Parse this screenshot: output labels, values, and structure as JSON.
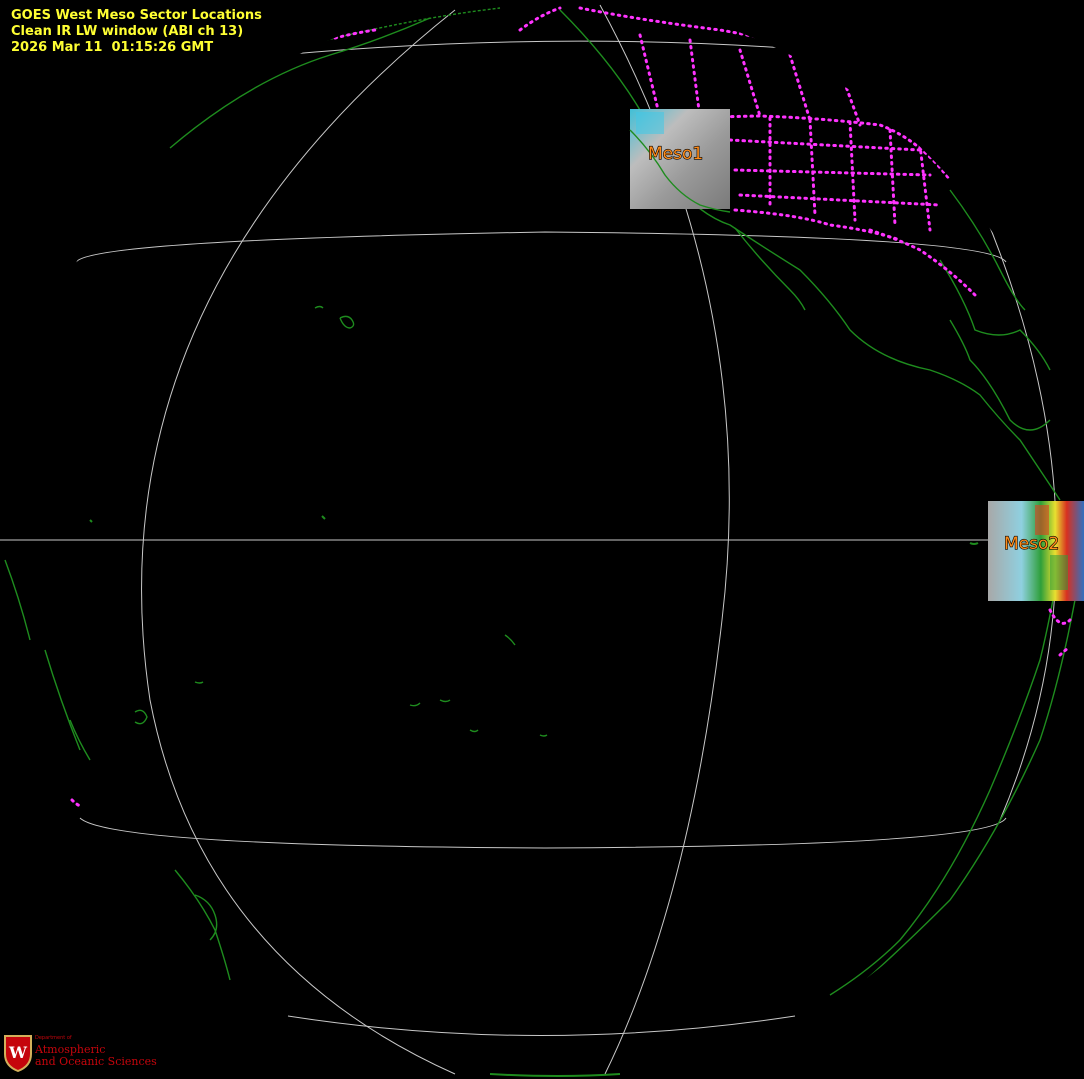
{
  "header": {
    "line1": "GOES West Meso Sector Locations",
    "line2": "Clean IR LW window (ABI ch 13)",
    "line3": "2026 Mar 11  01:15:26 GMT"
  },
  "sectors": [
    {
      "id": "meso1",
      "label": "Meso1"
    },
    {
      "id": "meso2",
      "label": "Meso2"
    }
  ],
  "logo": {
    "small_text": "Department of",
    "line1": "Atmospheric",
    "line2": "and Oceanic Sciences",
    "emblem_letter": "W"
  },
  "colors": {
    "background": "#000000",
    "graticule": "#c8c8c8",
    "coastline": "#1e8c1e",
    "borders": "#ff33ff",
    "title_text": "#ffff33",
    "sector_label": "#ff8c1a",
    "logo_red": "#c5050c"
  }
}
